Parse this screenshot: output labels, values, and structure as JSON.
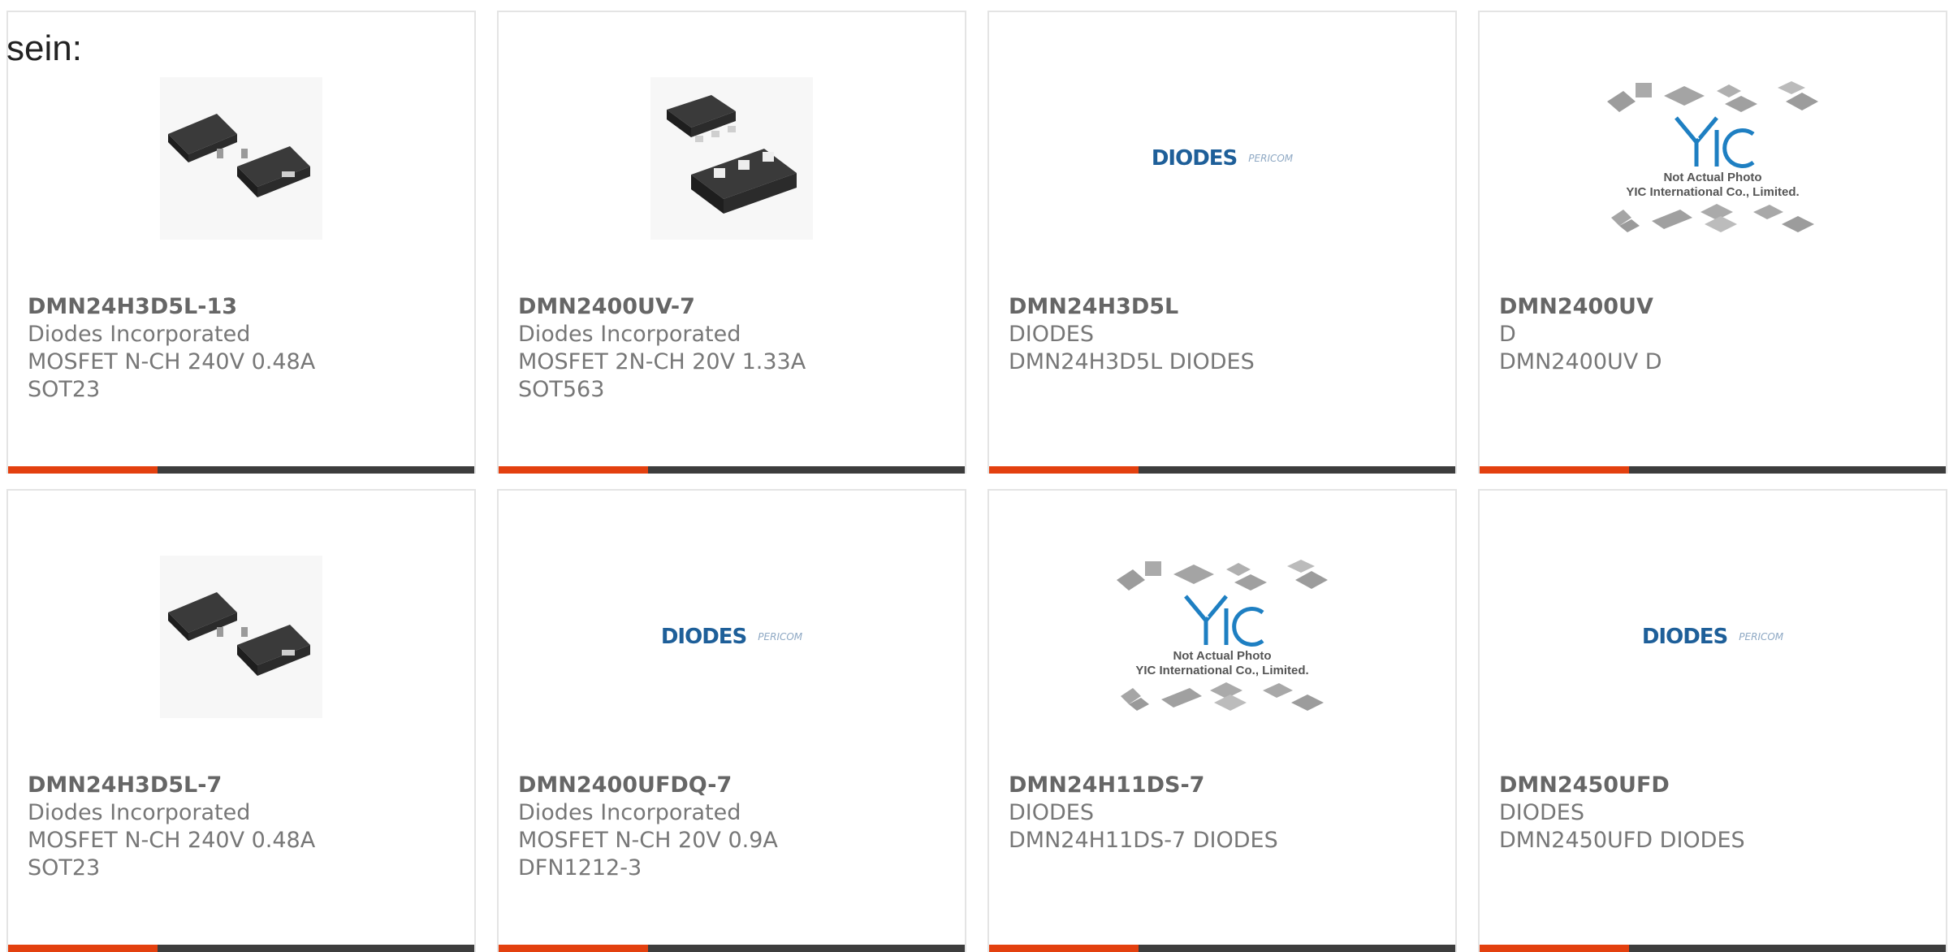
{
  "intro_text": "sein:",
  "colors": {
    "accent": "#e3400f",
    "bar": "#3d3d3d",
    "text": "#777777"
  },
  "products": [
    {
      "part_number": "DMN24H3D5L-13",
      "manufacturer": "Diodes Incorporated",
      "description": "MOSFET N-CH 240V 0.48A SOT23",
      "image": "sot23-package-photo"
    },
    {
      "part_number": "DMN2400UV-7",
      "manufacturer": "Diodes Incorporated",
      "description": "MOSFET 2N-CH 20V 1.33A SOT563",
      "image": "sot563-package-photo"
    },
    {
      "part_number": "DMN24H3D5L",
      "manufacturer": "DIODES",
      "description": "DMN24H3D5L DIODES",
      "image": "diodes-pericom-logo"
    },
    {
      "part_number": "DMN2400UV",
      "manufacturer": "D",
      "description": "DMN2400UV D",
      "image": "yic-not-actual-photo"
    },
    {
      "part_number": "DMN24H3D5L-7",
      "manufacturer": "Diodes Incorporated",
      "description": "MOSFET N-CH 240V 0.48A SOT23",
      "image": "sot23-package-photo"
    },
    {
      "part_number": "DMN2400UFDQ-7",
      "manufacturer": "Diodes Incorporated",
      "description": "MOSFET N-CH 20V 0.9A DFN1212-3",
      "image": "diodes-pericom-logo"
    },
    {
      "part_number": "DMN24H11DS-7",
      "manufacturer": "DIODES",
      "description": "DMN24H11DS-7 DIODES",
      "image": "yic-not-actual-photo"
    },
    {
      "part_number": "DMN2450UFD",
      "manufacturer": "DIODES",
      "description": "DMN2450UFD DIODES",
      "image": "diodes-pericom-logo"
    }
  ],
  "yic_image": {
    "line1": "Not Actual Photo",
    "line2": "YIC International Co., Limited."
  },
  "diodes_logo": {
    "main": "DIODES",
    "sub": "PERICOM"
  }
}
